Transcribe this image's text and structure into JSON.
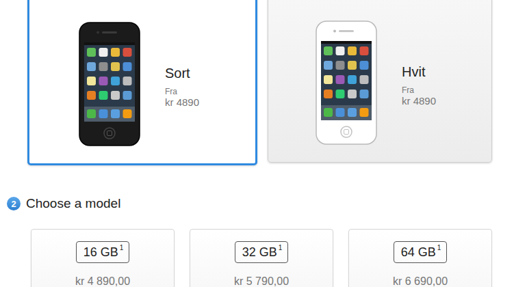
{
  "colors": [
    {
      "name": "Sort",
      "from_label": "Fra",
      "price": "kr 4890",
      "selected": true,
      "color": "#1b1b1b"
    },
    {
      "name": "Hvit",
      "from_label": "Fra",
      "price": "kr 4890",
      "selected": false,
      "color": "#ffffff"
    }
  ],
  "step": {
    "number": "2",
    "title": "Choose a model"
  },
  "models": [
    {
      "capacity": "16 GB",
      "footnote": "1",
      "price": "kr 4 890,00",
      "selected": false
    },
    {
      "capacity": "32 GB",
      "footnote": "1",
      "price": "kr 5 790,00",
      "selected": false
    },
    {
      "capacity": "64 GB",
      "footnote": "1",
      "price": "kr 6 690,00",
      "selected": false
    }
  ]
}
